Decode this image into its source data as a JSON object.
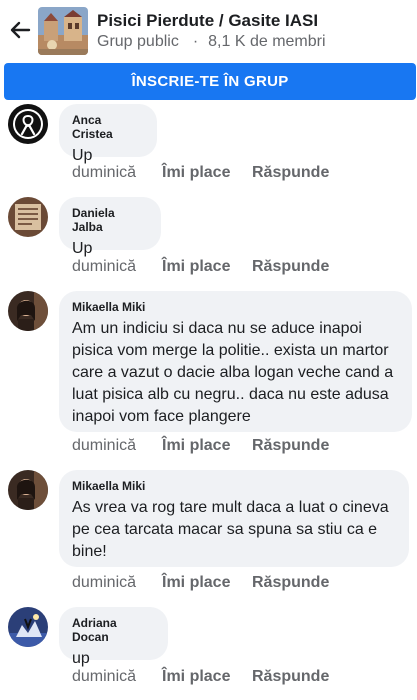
{
  "header": {
    "title": "Pisici Pierdute / Gasite IASI",
    "privacy": "Grup public",
    "separator": "·",
    "members": "8,1 K de membri"
  },
  "join_button": "ÎNSCRIE-TE ÎN GRUP",
  "actions": {
    "like": "Îmi place",
    "reply": "Răspunde"
  },
  "comments": [
    {
      "author": "Anca Cristea",
      "text": "Up",
      "day": "duminică"
    },
    {
      "author": "Daniela Jalba",
      "text": "Up",
      "day": "duminică"
    },
    {
      "author": "Mikaella Miki",
      "text": "Am un indiciu si daca nu se aduce inapoi pisica vom merge la politie.. exista un martor care a vazut o dacie alba logan veche cand a luat pisica alb cu negru.. daca nu este adusa inapoi vom face plangere",
      "day": "duminică"
    },
    {
      "author": "Mikaella Miki",
      "text": "As vrea va rog tare mult daca a luat o cineva pe cea tarcata macar sa spuna sa stiu ca e bine!",
      "day": "duminică"
    },
    {
      "author": "Adriana Docan",
      "text": "up",
      "day": "duminică"
    }
  ]
}
